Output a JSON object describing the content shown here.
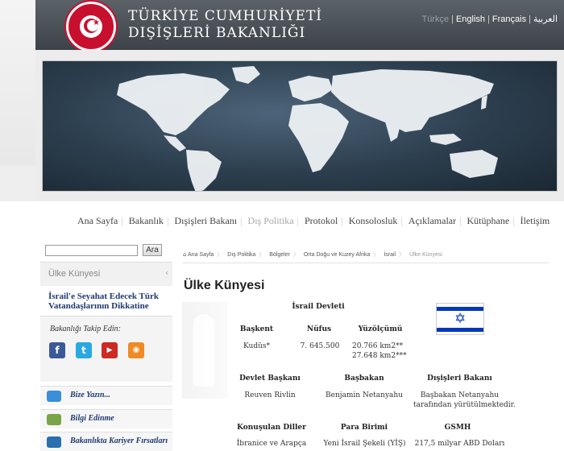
{
  "header": {
    "title_line1": "TÜRKİYE CUMHURİYETİ",
    "title_line2": "DIŞİŞLERİ BAKANLIĞI",
    "languages": [
      {
        "label": "Türkçe",
        "active": true
      },
      {
        "label": "English",
        "active": false
      },
      {
        "label": "Français",
        "active": false
      },
      {
        "label": "العربية",
        "active": false
      }
    ]
  },
  "nav": {
    "items": [
      "Ana Sayfa",
      "Bakanlık",
      "Dışişleri Bakanı",
      "Dış Politika",
      "Protokol",
      "Konsolosluk",
      "Açıklamalar",
      "Kütüphane",
      "İletişim"
    ],
    "active": "Dış Politika"
  },
  "sidebar": {
    "search_button": "Ara",
    "country_title": "Ülke Künyesi",
    "travel_link": "İsrail'e Seyahat Edecek Türk Vatandaşlarının Dikkatine",
    "follow_label": "Bakanlığı Takip Edin:",
    "links": [
      {
        "label": "Bize Yazın...",
        "icon": "speech-bubble-icon"
      },
      {
        "label": "Bilgi Edinme",
        "icon": "info-network-icon"
      },
      {
        "label": "Bakanlıkta Kariyer Fırsatları",
        "icon": "briefcase-icon"
      }
    ],
    "social": [
      {
        "name": "facebook-icon",
        "glyph": "f",
        "color": "#3b5998"
      },
      {
        "name": "twitter-icon",
        "glyph": "t",
        "color": "#29a9e1"
      },
      {
        "name": "youtube-icon",
        "glyph": "▶",
        "color": "#cc2a22"
      },
      {
        "name": "rss-icon",
        "glyph": "◉",
        "color": "#f08a24"
      }
    ]
  },
  "breadcrumb": [
    "Ana Sayfa",
    "Dış Politika",
    "Bölgeler",
    "Orta Doğu ve Kuzey Afrika",
    "İsrail",
    "Ülke Künyesi"
  ],
  "page_title": "Ülke Künyesi",
  "country": {
    "name": "İsrail Devleti",
    "rows": [
      {
        "labels": [
          "Başkent",
          "Nüfus",
          "Yüzölçümü"
        ],
        "values": [
          "Kudüs*",
          "7. 645.500",
          "20.766 km2**"
        ],
        "extra": "27.648 km2***"
      },
      {
        "labels": [
          "Devlet Başkanı",
          "Başbakan",
          "Dışişleri Bakanı"
        ],
        "values": [
          "Reuven Rivlin",
          "Benjamin Netanyahu",
          "Başbakan Netanyahu"
        ],
        "extra": "tarafından yürütülmektedir."
      },
      {
        "labels": [
          "Konuşulan Diller",
          "Para Birimi",
          "GSMH"
        ],
        "values": [
          "İbranice ve Arapça",
          "Yeni İsrail Şekeli (YİŞ)",
          "217,5 milyar ABD Doları"
        ]
      }
    ]
  },
  "colors": {
    "header_bg": "#4a5157",
    "brand_red": "#c8102e",
    "link_blue": "#1f3a70",
    "flag_blue": "#0038b8"
  }
}
